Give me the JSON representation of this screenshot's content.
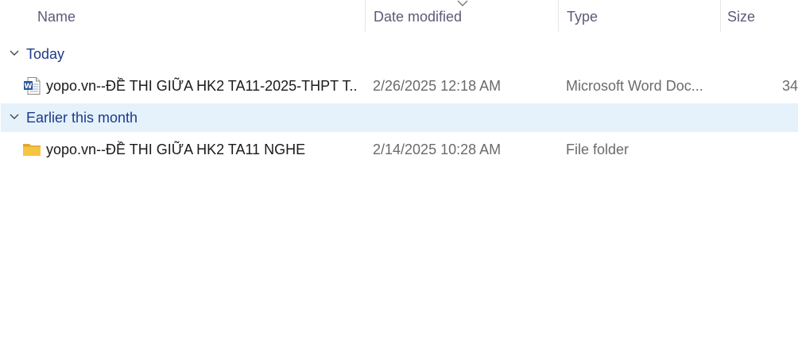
{
  "columns": {
    "name": "Name",
    "date_modified": "Date modified",
    "type": "Type",
    "size": "Size"
  },
  "sort": {
    "column": "date_modified",
    "icon": "chevron-down-icon"
  },
  "groups": [
    {
      "label": "Today",
      "selected": false,
      "items": [
        {
          "name": "yopo.vn--ĐỀ THI GIỮA HK2 TA11-2025-THPT T...",
          "date": "2/26/2025 12:18 AM",
          "type": "Microsoft Word Doc...",
          "size": "34",
          "icon": "word-document-icon"
        }
      ]
    },
    {
      "label": "Earlier this month",
      "selected": true,
      "items": [
        {
          "name": "yopo.vn--ĐỀ THI GIỮA HK2 TA11 NGHE",
          "date": "2/14/2025 10:28 AM",
          "type": "File folder",
          "size": "",
          "icon": "folder-icon"
        }
      ]
    }
  ],
  "colors": {
    "group_text": "#1e3a8a",
    "selected_bg": "#e5f1fb",
    "header_text": "#5b5b7a",
    "secondary_text": "#6b6b6b",
    "folder": "#f5c542",
    "word": "#2b579a"
  }
}
